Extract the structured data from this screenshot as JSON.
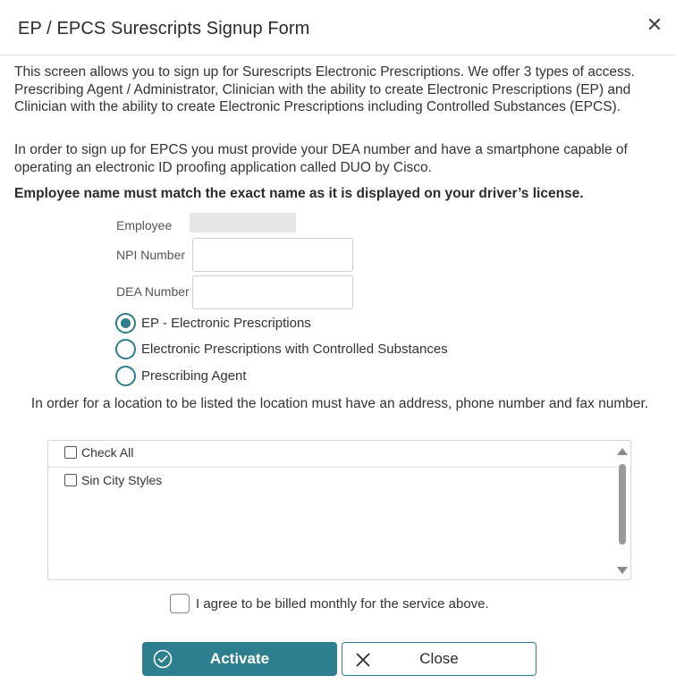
{
  "dialog": {
    "title": "EP / EPCS Surescripts Signup Form",
    "close_icon": "close-icon"
  },
  "intro": {
    "paragraph1": "This screen allows you to sign up for Surescripts Electronic Prescriptions. We offer 3 types of access. Prescribing Agent / Administrator, Clinician with the ability to create Electronic Prescriptions (EP) and Clinician with the ability to create Electronic Prescriptions including Controlled Substances (EPCS).",
    "paragraph2": "In order to sign up for EPCS you must provide your DEA number and have a smartphone capable of operating an electronic ID proofing application called DUO by Cisco.",
    "warning": "Employee name must match the exact name as it is displayed on your driver’s license."
  },
  "form": {
    "employee_label": "Employee",
    "npi_label": "NPI Number",
    "npi_value": "",
    "dea_label": "DEA Number",
    "dea_value": ""
  },
  "access_types": [
    {
      "label": "EP - Electronic Prescriptions",
      "selected": true
    },
    {
      "label": "Electronic Prescriptions with Controlled Substances",
      "selected": false
    },
    {
      "label": "Prescribing Agent",
      "selected": false
    }
  ],
  "locations": {
    "note": "In order for a location to be listed the location must have an address, phone number and fax number.",
    "check_all_label": "Check All",
    "items": [
      {
        "label": "Sin City Styles",
        "checked": false
      }
    ]
  },
  "agreement": {
    "label": "I agree to be billed monthly for the service above.",
    "checked": false
  },
  "buttons": {
    "activate_label": "Activate",
    "activate_icon": "check-circle-icon",
    "close_label": "Close",
    "close_icon": "x-icon"
  },
  "colors": {
    "accent": "#2d7f8f",
    "radio": "#2e7d8c"
  }
}
